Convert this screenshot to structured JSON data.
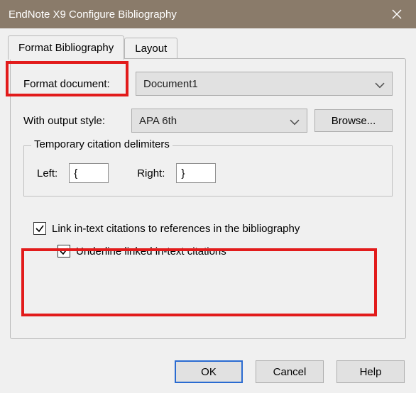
{
  "window": {
    "title": "EndNote X9 Configure Bibliography"
  },
  "tabs": {
    "format": "Format Bibliography",
    "layout": "Layout"
  },
  "form": {
    "format_document_label": "Format document:",
    "format_document_value": "Document1",
    "output_style_label": "With output style:",
    "output_style_value": "APA 6th",
    "browse_label": "Browse..."
  },
  "group": {
    "title": "Temporary citation delimiters",
    "left_label": "Left:",
    "left_value": "{",
    "right_label": "Right:",
    "right_value": "}"
  },
  "checks": {
    "link_label": "Link in-text citations to references in the bibliography",
    "underline_label": "Underline linked in-text citations"
  },
  "buttons": {
    "ok": "OK",
    "cancel": "Cancel",
    "help": "Help"
  }
}
